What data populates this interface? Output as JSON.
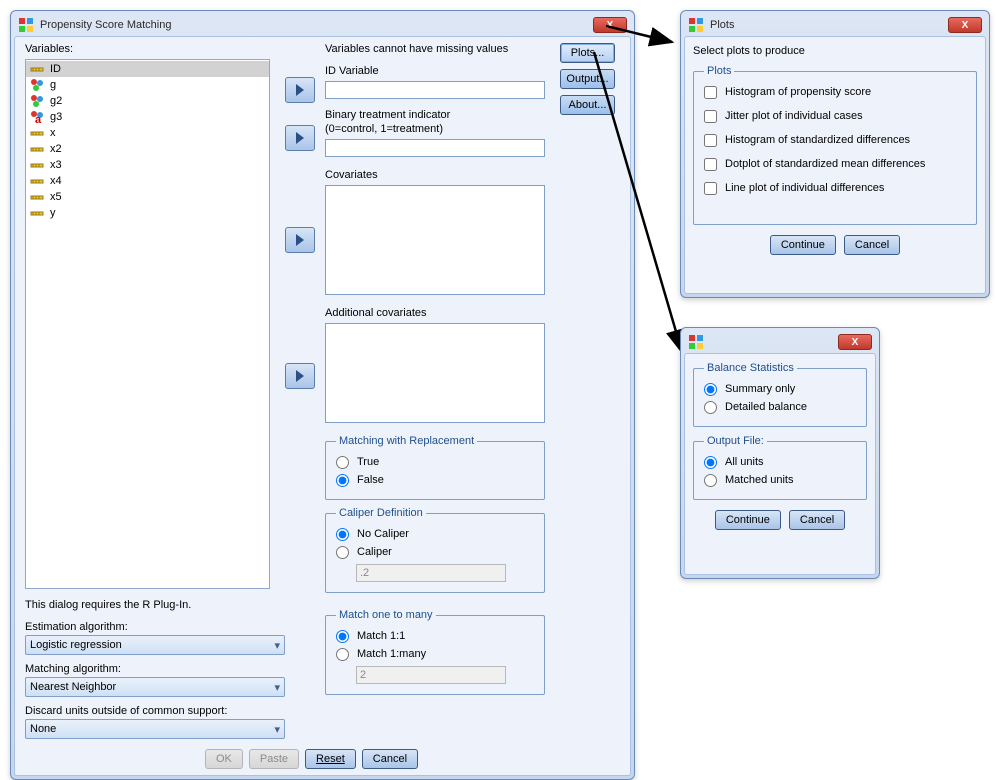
{
  "main": {
    "title": "Propensity Score Matching",
    "variables_label": "Variables:",
    "variables": [
      "ID",
      "g",
      "g2",
      "g3",
      "x",
      "x2",
      "x3",
      "x4",
      "x5",
      "y"
    ],
    "variables_icons": [
      "scale",
      "nominal",
      "nominal",
      "nominal-a",
      "scale",
      "scale",
      "scale",
      "scale",
      "scale",
      "scale"
    ],
    "selected_var": "ID",
    "plug_in_note": "This dialog requires the R Plug-In.",
    "est_algo_label": "Estimation algorithm:",
    "est_algo_value": "Logistic regression",
    "match_algo_label": "Matching algorithm:",
    "match_algo_value": "Nearest Neighbor",
    "discard_label": "Discard units outside of common support:",
    "discard_value": "None",
    "warning": "Variables cannot have missing values",
    "id_var_label": "ID Variable",
    "bti_label1": "Binary treatment indicator",
    "bti_label2": "(0=control, 1=treatment)",
    "covariates_label": "Covariates",
    "addl_cov_label": "Additional covariates",
    "replace_legend": "Matching with Replacement",
    "replace_true": "True",
    "replace_false": "False",
    "caliper_legend": "Caliper Definition",
    "caliper_none": "No Caliper",
    "caliper_yes": "Caliper",
    "caliper_value": ".2",
    "many_legend": "Match one to many",
    "many_11": "Match 1:1",
    "many_1m": "Match 1:many",
    "many_value": "2",
    "side_plots": "Plots...",
    "side_output": "Output...",
    "side_about": "About...",
    "btn_ok": "OK",
    "btn_paste": "Paste",
    "btn_reset": "Reset",
    "btn_cancel": "Cancel"
  },
  "plots": {
    "title": "Plots",
    "select_label": "Select plots to produce",
    "legend": "Plots",
    "items": [
      "Histogram of propensity score",
      "Jitter plot of individual cases",
      "Histogram of standardized differences",
      "Dotplot of standardized mean differences",
      "Line plot of individual differences"
    ],
    "continue": "Continue",
    "cancel": "Cancel"
  },
  "output": {
    "bs_legend": "Balance Statistics",
    "bs_summary": "Summary only",
    "bs_detailed": "Detailed balance",
    "of_legend": "Output File:",
    "of_all": "All units",
    "of_matched": "Matched units",
    "continue": "Continue",
    "cancel": "Cancel"
  }
}
